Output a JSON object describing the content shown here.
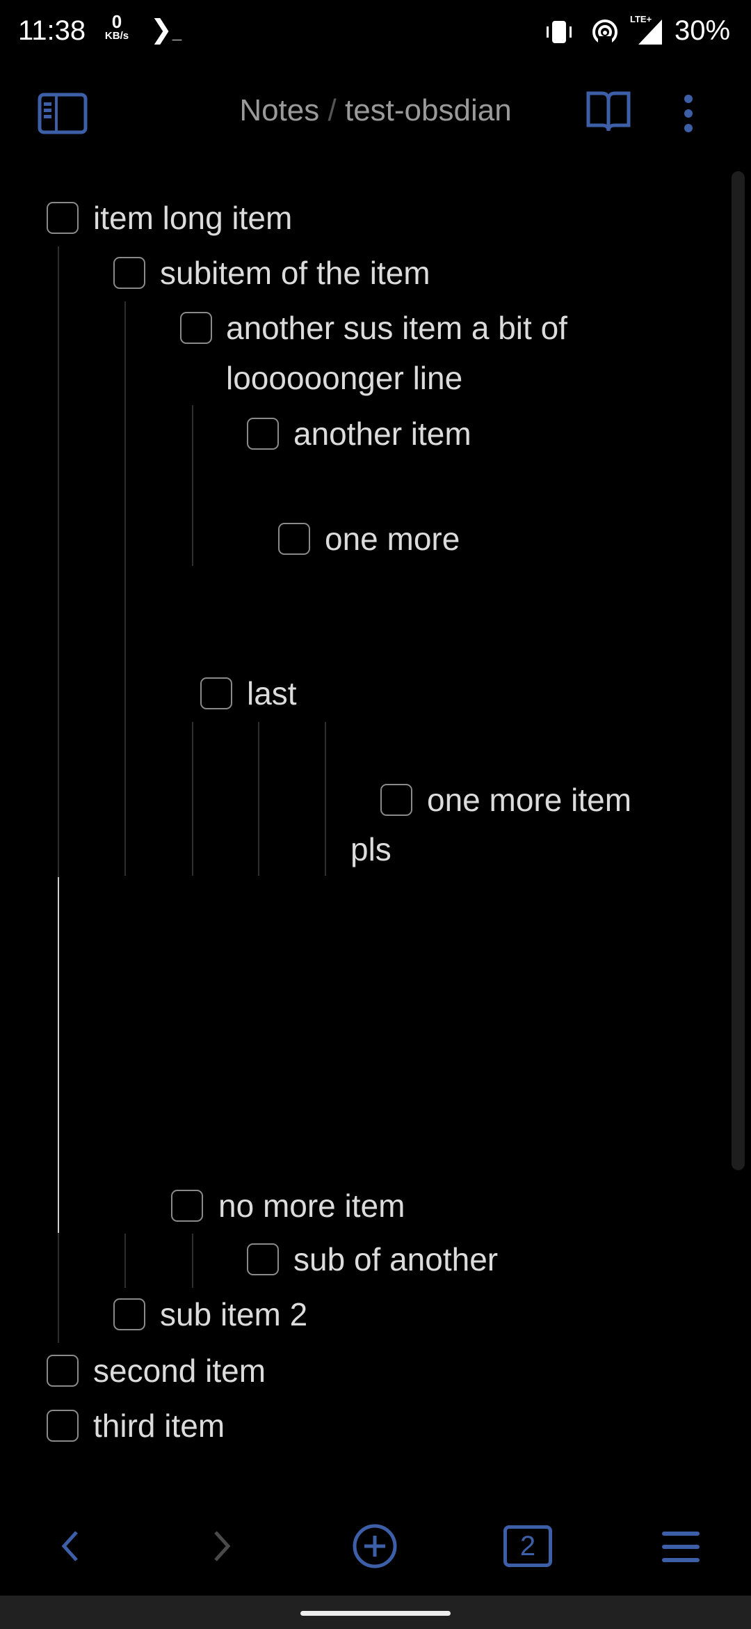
{
  "status_bar": {
    "time": "11:38",
    "net_speed_value": "0",
    "net_speed_unit": "KB/s",
    "network_label": "LTE+",
    "battery": "30%",
    "icons": [
      "terminal-icon",
      "vibrate-icon",
      "hotspot-icon",
      "signal-icon"
    ]
  },
  "header": {
    "breadcrumb_parent": "Notes",
    "separator": "/",
    "title": "test-obsdian",
    "icons": [
      "sidebar-toggle-icon",
      "reading-view-icon",
      "more-options-icon"
    ]
  },
  "items": [
    {
      "text": "item long item",
      "checked": false
    },
    {
      "text": "subitem of the item",
      "checked": false
    },
    {
      "text": "another sus item a bit of",
      "text2": "loooooonger line",
      "checked": false
    },
    {
      "text": "another item",
      "checked": false
    },
    {
      "text": "one more",
      "checked": false
    },
    {
      "text": "last",
      "checked": false
    },
    {
      "text": "one more item",
      "text2": "pls",
      "checked": false
    },
    {
      "text": "no more item",
      "checked": false
    },
    {
      "text": "sub of another",
      "checked": false
    },
    {
      "text": "sub item 2",
      "checked": false
    },
    {
      "text": "second item",
      "checked": false
    },
    {
      "text": "third item",
      "checked": false
    }
  ],
  "bottom_nav": {
    "tab_count": "2",
    "icons": [
      "back-icon",
      "forward-icon",
      "new-note-icon",
      "tabs-icon",
      "menu-icon"
    ]
  },
  "colors": {
    "accent": "#3d5fa8",
    "text": "#dcdcdc",
    "background": "#000000"
  }
}
